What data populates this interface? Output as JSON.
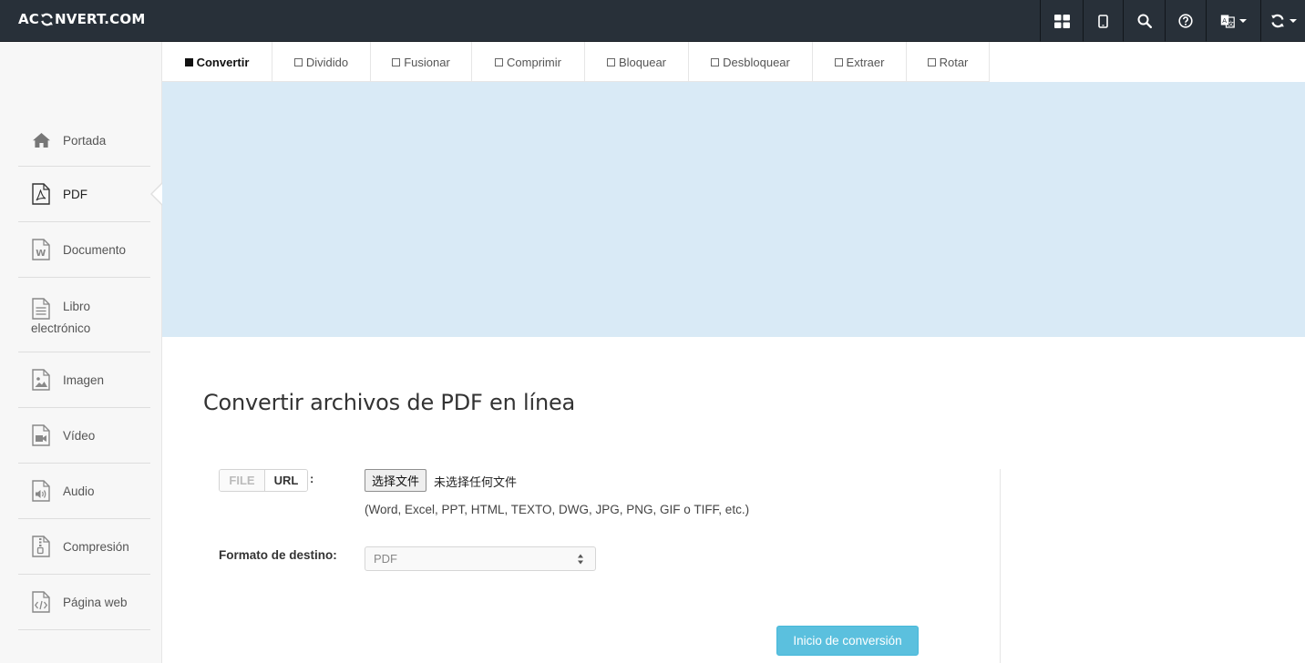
{
  "header": {
    "logo_prefix": "AC",
    "logo_suffix": "NVERT.COM",
    "icons": [
      "apps-grid-icon",
      "mobile-icon",
      "search-icon",
      "help-icon",
      "language-icon",
      "refresh-icon"
    ]
  },
  "tabs": [
    {
      "label": "Convertir",
      "active": true
    },
    {
      "label": "Dividido",
      "active": false
    },
    {
      "label": "Fusionar",
      "active": false
    },
    {
      "label": "Comprimir",
      "active": false
    },
    {
      "label": "Bloquear",
      "active": false
    },
    {
      "label": "Desbloquear",
      "active": false
    },
    {
      "label": "Extraer",
      "active": false
    },
    {
      "label": "Rotar",
      "active": false
    }
  ],
  "sidebar": {
    "items": [
      {
        "label": "Portada",
        "icon": "home-icon"
      },
      {
        "label": "PDF",
        "icon": "pdf-file-icon",
        "active": true
      },
      {
        "label": "Documento",
        "icon": "word-document-icon"
      },
      {
        "label_line1": "Libro",
        "label_line2": "electrónico",
        "icon": "ebook-icon"
      },
      {
        "label": "Imagen",
        "icon": "image-file-icon"
      },
      {
        "label": "Vídeo",
        "icon": "video-file-icon"
      },
      {
        "label": "Audio",
        "icon": "audio-file-icon"
      },
      {
        "label": "Compresión",
        "icon": "archive-file-icon"
      },
      {
        "label": "Página web",
        "icon": "code-file-icon"
      }
    ]
  },
  "main": {
    "title": "Convertir archivos de PDF en línea",
    "source_toggle": {
      "file": "FILE",
      "url": "URL",
      "selected": "URL"
    },
    "colon": ":",
    "file_button": "选择文件",
    "file_status": "未选择任何文件",
    "formats_hint": "(Word, Excel, PPT, HTML, TEXTO, DWG, JPG, PNG, GIF o TIFF, etc.)",
    "target_label": "Formato de destino:",
    "target_value": "PDF",
    "submit_label": "Inicio de conversión"
  },
  "colors": {
    "topbar": "#283039",
    "banner": "#d9eaf6",
    "submit": "#5bc0de"
  }
}
